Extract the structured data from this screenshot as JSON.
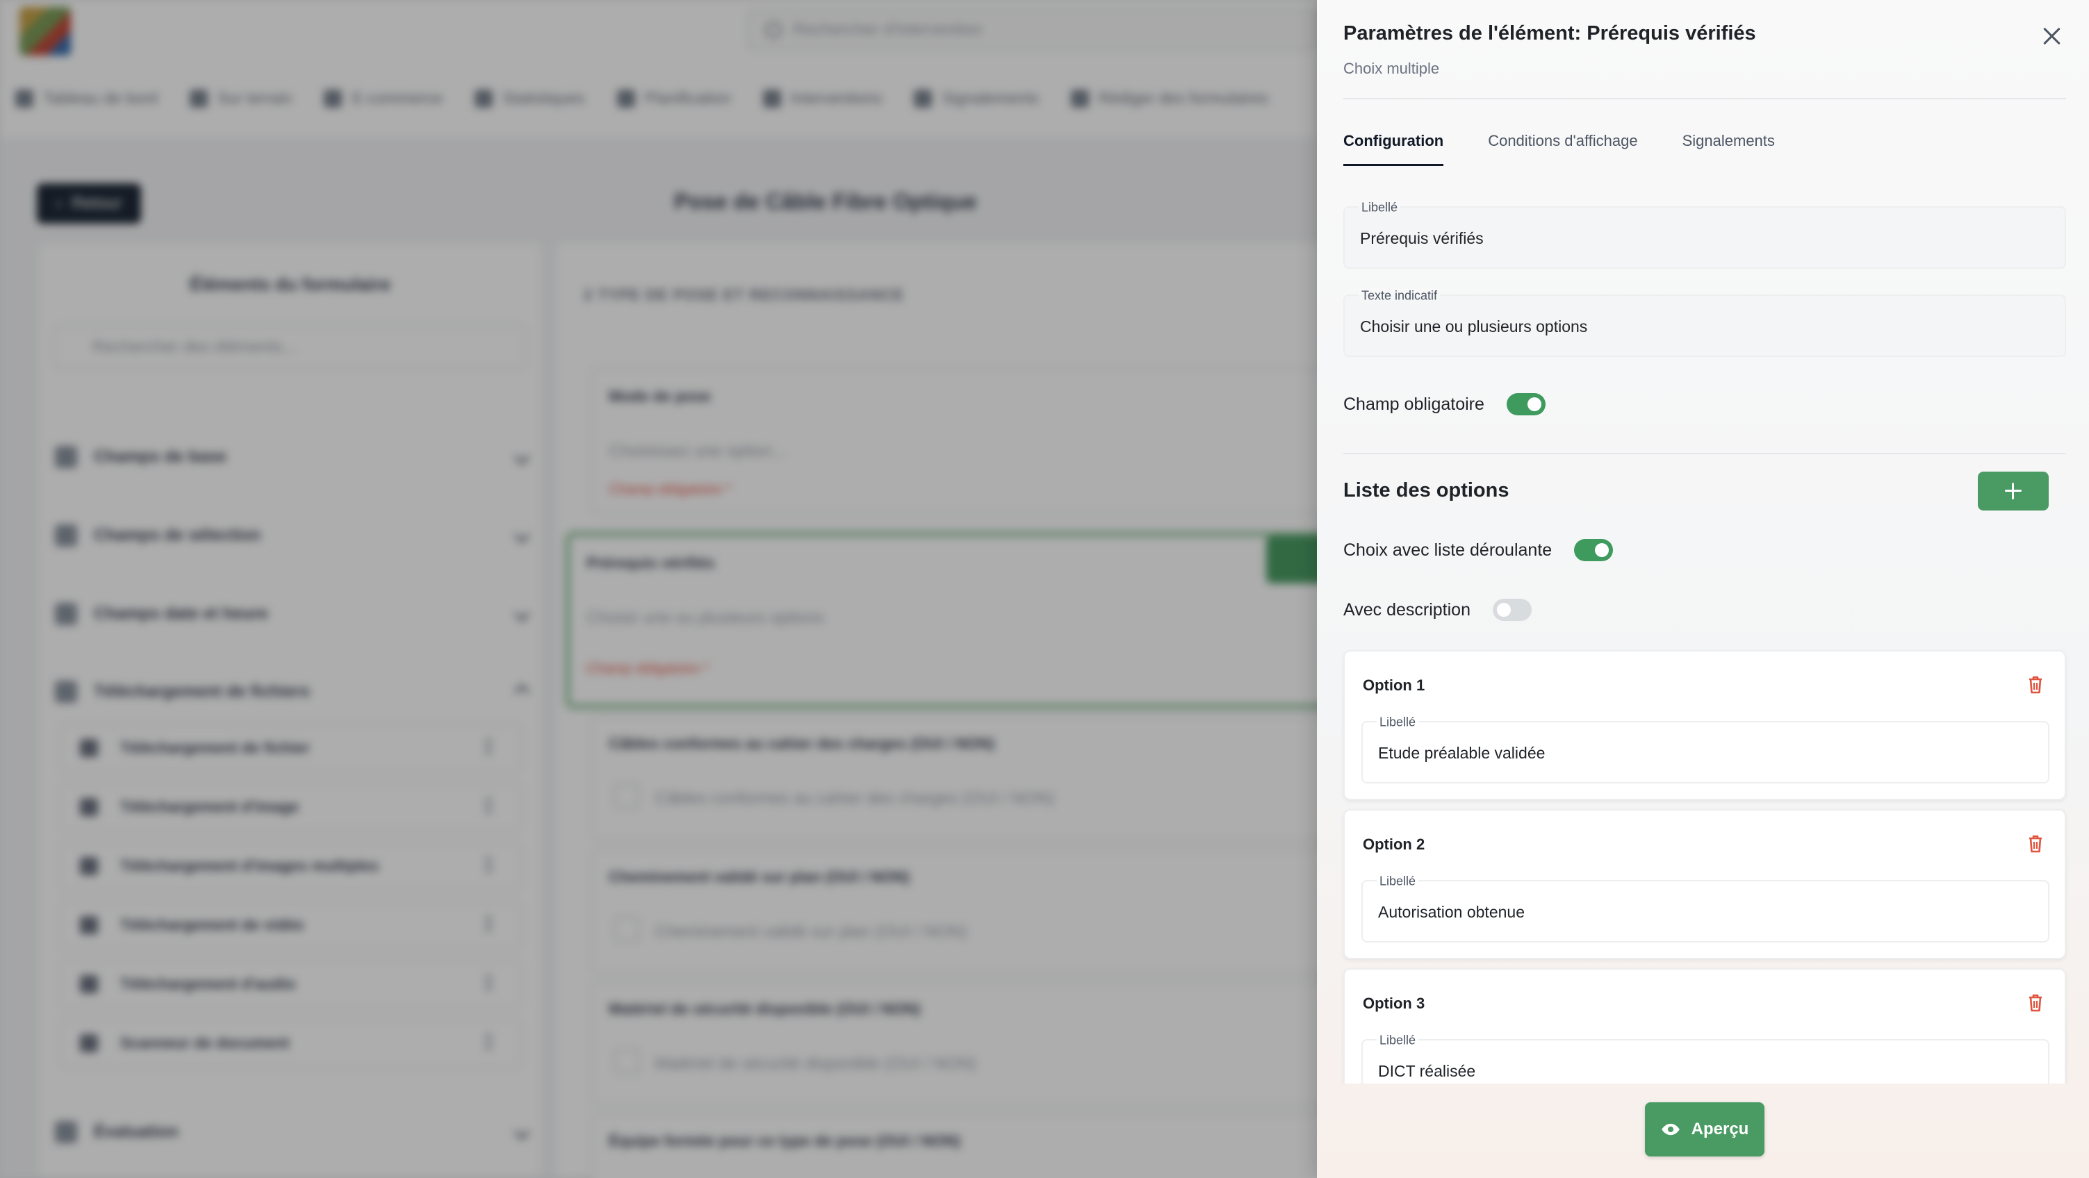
{
  "background": {
    "search_placeholder": "Rechercher d'intervention",
    "nav": [
      "Tableau de bord",
      "Sur terrain",
      "E-commerce",
      "Statistiques",
      "Planification",
      "Interventions",
      "Signalements",
      "Rédiger des formulaires"
    ],
    "back_label": "Retour",
    "page_title": "Pose de Câble Fibre Optique",
    "left_panel": {
      "title": "Éléments du formulaire",
      "search_placeholder": "Rechercher des éléments...",
      "groups": [
        "Champs de base",
        "Champs de sélection",
        "Champs date et heure",
        "Téléchargement de fichiers"
      ],
      "upload_items": [
        "Téléchargement de fichier",
        "Téléchargement d'image",
        "Téléchargement d'images multiples",
        "Téléchargement de vidéo",
        "Téléchargement d'audio",
        "Scanneur de document"
      ],
      "last_group": "Évaluation"
    },
    "main": {
      "section": "2 TYPE DE POSE ET RECONNAISSANCE",
      "cards": [
        {
          "label": "Mode de pose",
          "value": "Choisissez une option...",
          "required": "Champ obligatoire *"
        },
        {
          "label": "Prérequis vérifiés",
          "value": "Choisir une ou plusieurs options",
          "required": "Champ obligatoire *"
        },
        {
          "label": "Câbles conformes au cahier des charges (OUI / NON)",
          "value": "Câbles conformes au cahier des charges (OUI / NON)"
        },
        {
          "label": "Cheminement validé sur plan (OUI / NON)",
          "value": "Cheminement validé sur plan (OUI / NON)"
        },
        {
          "label": "Matériel de sécurité disponible (OUI / NON)",
          "value": "Matériel de sécurité disponible (OUI / NON)"
        },
        {
          "label": "Équipe formée pour ce type de pose (OUI / NON)"
        }
      ]
    }
  },
  "drawer": {
    "title": "Paramètres de l'élément: Prérequis vérifiés",
    "subtitle": "Choix multiple",
    "tabs": [
      "Configuration",
      "Conditions d'affichage",
      "Signalements"
    ],
    "active_tab": "Configuration",
    "label_field": {
      "label": "Libellé",
      "value": "Prérequis vérifiés"
    },
    "hint_field": {
      "label": "Texte indicatif",
      "value": "Choisir une ou plusieurs options"
    },
    "required_toggle": {
      "label": "Champ obligatoire",
      "on": true
    },
    "options_section": {
      "title": "Liste des options",
      "dropdown_toggle": {
        "label": "Choix avec liste déroulante",
        "on": true
      },
      "description_toggle": {
        "label": "Avec description",
        "on": false
      },
      "options": [
        {
          "title": "Option 1",
          "field_label": "Libellé",
          "value": "Etude préalable validée"
        },
        {
          "title": "Option 2",
          "field_label": "Libellé",
          "value": "Autorisation obtenue"
        },
        {
          "title": "Option 3",
          "field_label": "Libellé",
          "value": "DICT réalisée"
        }
      ]
    },
    "preview_label": "Aperçu"
  },
  "colors": {
    "accent": "#4a9b63",
    "toggle_on": "#3f9a5e",
    "danger": "#e0533d"
  }
}
